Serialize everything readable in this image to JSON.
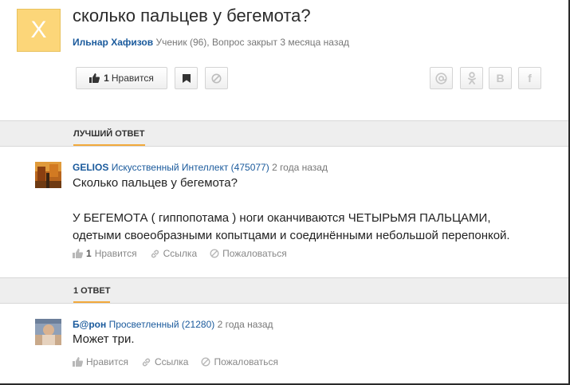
{
  "question": {
    "avatar_letter": "X",
    "title": "сколько пальцев у бегемота?",
    "author": "Ильнар Хафизов",
    "meta": "Ученик (96), Вопрос закрыт 3 месяца назад",
    "like_count": "1",
    "like_label": "Нравится"
  },
  "share": {
    "mail_icon": "mail-at-icon",
    "ok_icon": "odnoklassniki-icon",
    "vk_label": "В",
    "fb_label": "f"
  },
  "best_section": {
    "label": "ЛУЧШИЙ ОТВЕТ"
  },
  "best_answer": {
    "author": "GELIOS",
    "rank": "Искусственный Интеллект (475077)",
    "time": "2 года назад",
    "lines": [
      "Сколько пальцев у бегемота?",
      "",
      "У БЕГЕМОТА ( гиппопотама ) ноги оканчиваются ЧЕТЫРЬМЯ ПАЛЬЦАМИ,",
      "одетыми своеобразными копытцами и соединёнными небольшой перепонкой."
    ],
    "like_count": "1",
    "like_label": "Нравится",
    "link_label": "Ссылка",
    "report_label": "Пожаловаться"
  },
  "answers_section": {
    "label": "1 ОТВЕТ"
  },
  "answer": {
    "author": "Б@рон",
    "rank": "Просветленный (21280)",
    "time": "2 года назад",
    "text": "Может три.",
    "like_label": "Нравится",
    "link_label": "Ссылка",
    "report_label": "Пожаловаться"
  },
  "colors": {
    "accent": "#f2a93b",
    "author_link": "#1a5a9c",
    "avatar_bg": "#fcd679"
  }
}
